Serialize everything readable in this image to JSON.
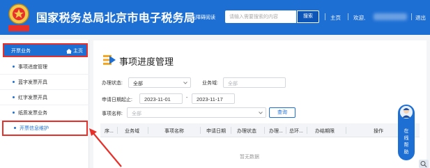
{
  "header": {
    "site_title": "国家税务总局北京市电子税务局",
    "barrier_free": "无障碍阅读",
    "search_placeholder": "请输入需要搜索的内容",
    "search_button": "搜索",
    "home_link": "主页",
    "welcome": "欢迎,",
    "logout": "退出",
    "emblem_text": "中国税务",
    "colors": {
      "primary": "#1e6fd4",
      "highlight": "#e8302b"
    }
  },
  "sidebar": {
    "section_title": "开票业务",
    "home_label": "主页",
    "items": [
      {
        "label": "事项进度管理",
        "active": false
      },
      {
        "label": "蓝字发票开具",
        "active": false
      },
      {
        "label": "红字发票开具",
        "active": false
      },
      {
        "label": "纸质发票业务",
        "active": false
      },
      {
        "label": "开票信息维护",
        "active": true
      }
    ]
  },
  "main": {
    "page_title": "事项进度管理",
    "filters": {
      "status_label": "办理状态:",
      "status_value": "全部",
      "domain_label": "业务域:",
      "domain_value": "全部",
      "date_label": "申请日期起止:",
      "date_start": "2023-11-01",
      "date_sep": "-",
      "date_end": "2023-11-17",
      "item_label": "事项名称:",
      "item_value": "全部",
      "query_button": "查询"
    },
    "table": {
      "columns": [
        "序...",
        "业务域",
        "事项名称",
        "申请日期",
        "办理状态",
        "办理...",
        "总环...",
        "办结期限",
        "操作"
      ],
      "empty_text": "暂无数据"
    }
  },
  "float_help": {
    "text": "在线帮助"
  }
}
